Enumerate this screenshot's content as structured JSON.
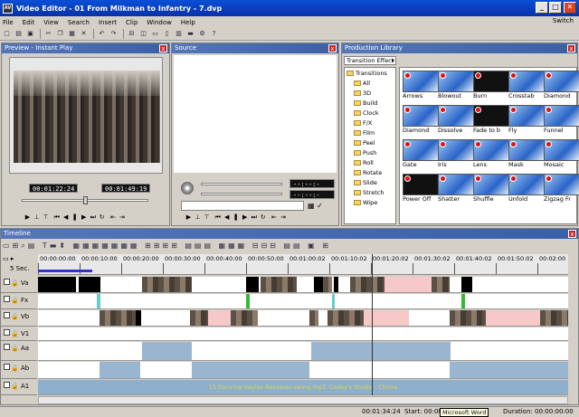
{
  "window": {
    "title": "Video Editor - 01 From Milkman to Infantry - 7.dvp",
    "app_icon": "AV",
    "min": "_",
    "max": "□",
    "close": "✕"
  },
  "menu": [
    "File",
    "Edit",
    "View",
    "Search",
    "Insert",
    "Clip",
    "Window",
    "Help"
  ],
  "switch_label": "Switch",
  "toolbar_icons": [
    "new-icon",
    "open-icon",
    "save-icon",
    "cut-icon",
    "copy-icon",
    "paste-icon",
    "delete-icon",
    "undo-icon",
    "redo-icon",
    "split-icon",
    "snapshot-icon",
    "preview-icon",
    "source-icon",
    "library-icon",
    "timeline-icon",
    "properties-icon",
    "help-icon"
  ],
  "preview": {
    "title": "Preview - Instant Play",
    "timecode_in": "00:01:22:24",
    "timecode_out": "00:01:49:19",
    "close": "x"
  },
  "source": {
    "title": "Source",
    "timecode_in": "--:--:--:--",
    "timecode_out": "--:--:--:--",
    "close": "x"
  },
  "library": {
    "title": "Production Library",
    "dropdown": "Transition Effect",
    "close": "x",
    "tree": [
      "Transitions",
      "All",
      "3D",
      "Build",
      "Clock",
      "F/X",
      "Film",
      "Peel",
      "Push",
      "Roll",
      "Rotate",
      "Slide",
      "Stretch",
      "Wipe"
    ],
    "tiles": [
      "Arrows",
      "Blowout",
      "Burn",
      "Crosstab",
      "Diamond",
      "Diamond",
      "Dissolve",
      "Fade to b",
      "Fly",
      "Funnel",
      "Gate",
      "Iris",
      "Lens",
      "Mask",
      "Mosaic",
      "Power Off",
      "Shatter",
      "Shuffle",
      "Unfold",
      "Zigzag Fr"
    ]
  },
  "timeline": {
    "title": "Timeline",
    "scale": "5 Sec.",
    "close": "x",
    "ruler": [
      "00:00:00:00",
      "00:00:10:00",
      "00:00:20:00",
      "00:00:30:00",
      "00:00:40:00",
      "00:00:50:00",
      "00:01:00:02",
      "00:01:10:02",
      "00:01:20:02",
      "00:01:30:02",
      "00:01:40:02",
      "00:01:50:02",
      "00:02:00"
    ],
    "tracks": [
      "Va",
      "Fx",
      "Vb",
      "V1",
      "Aa",
      "Ab",
      "A1"
    ],
    "a1_text": "15 Dancing Kayles Beeswax-swing.mp3, Cosby's Studio - Clocks"
  },
  "status": {
    "time": "00:01:34:24",
    "start": "Start: 00:00:00:10",
    "tooltip": "Microsoft Word",
    "duration": "Duration: 00:00:00:00"
  }
}
